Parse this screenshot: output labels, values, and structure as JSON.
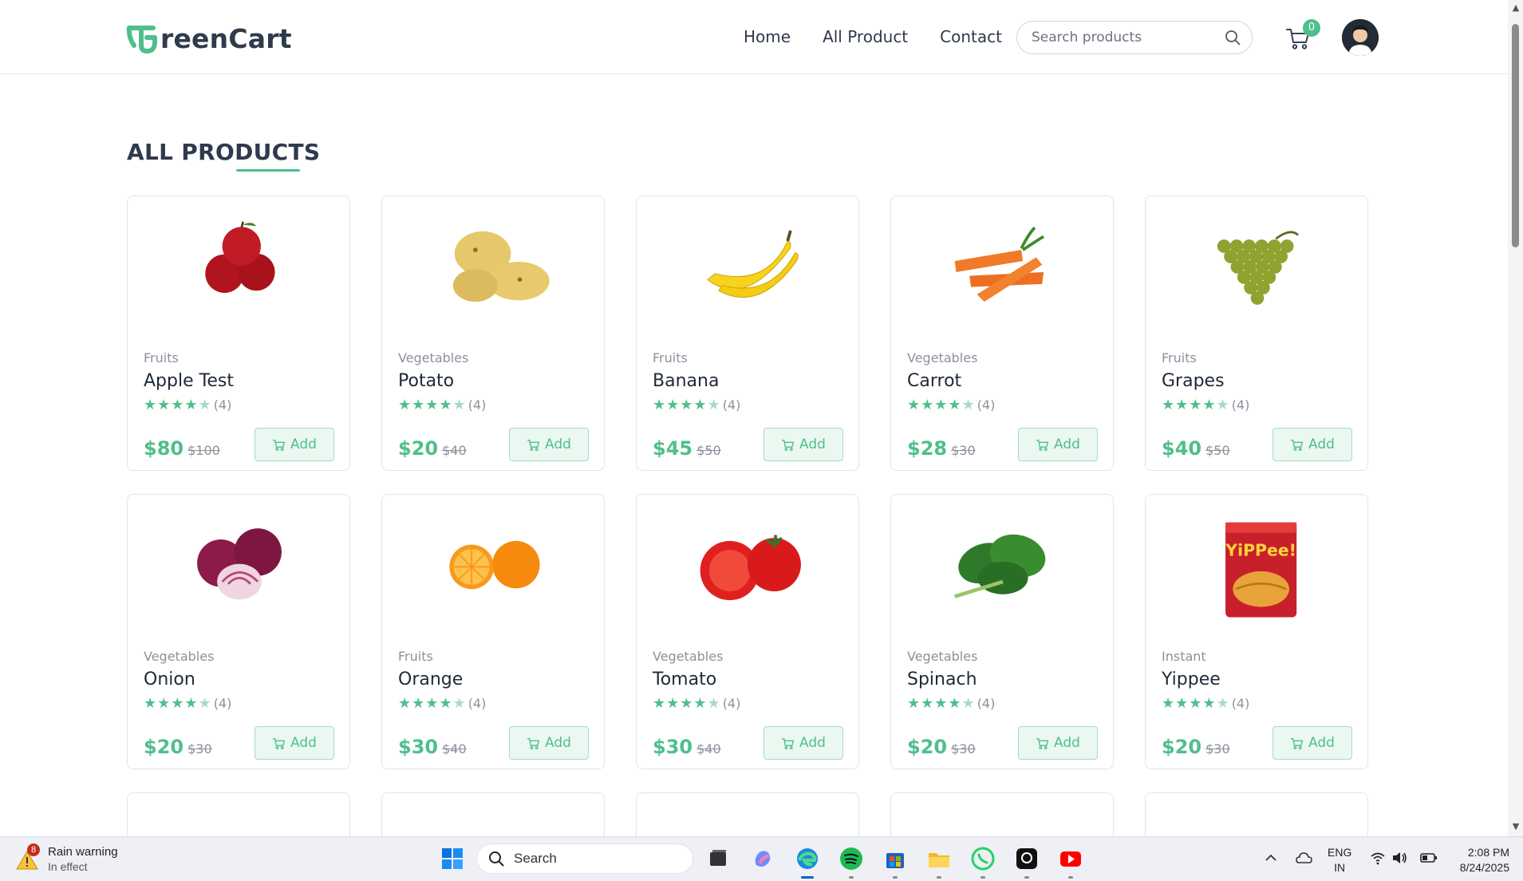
{
  "brand": {
    "name": "reenCart",
    "accent": "#4fbf8b"
  },
  "nav": {
    "links": [
      "Home",
      "All Product",
      "Contact"
    ]
  },
  "search": {
    "placeholder": "Search products"
  },
  "cart": {
    "count": "0"
  },
  "section": {
    "title": "ALL PRODUCTS"
  },
  "add_label": "Add",
  "products": [
    {
      "category": "Fruits",
      "name": "Apple Test",
      "rating": "(4)",
      "stars": 4,
      "price": "$80",
      "old_price": "$100",
      "image": "apple"
    },
    {
      "category": "Vegetables",
      "name": "Potato",
      "rating": "(4)",
      "stars": 4,
      "price": "$20",
      "old_price": "$40",
      "image": "potato"
    },
    {
      "category": "Fruits",
      "name": "Banana",
      "rating": "(4)",
      "stars": 4,
      "price": "$45",
      "old_price": "$50",
      "image": "banana"
    },
    {
      "category": "Vegetables",
      "name": "Carrot",
      "rating": "(4)",
      "stars": 4,
      "price": "$28",
      "old_price": "$30",
      "image": "carrot"
    },
    {
      "category": "Fruits",
      "name": "Grapes",
      "rating": "(4)",
      "stars": 4,
      "price": "$40",
      "old_price": "$50",
      "image": "grapes"
    },
    {
      "category": "Vegetables",
      "name": "Onion",
      "rating": "(4)",
      "stars": 4,
      "price": "$20",
      "old_price": "$30",
      "image": "onion"
    },
    {
      "category": "Fruits",
      "name": "Orange",
      "rating": "(4)",
      "stars": 4,
      "price": "$30",
      "old_price": "$40",
      "image": "orange"
    },
    {
      "category": "Vegetables",
      "name": "Tomato",
      "rating": "(4)",
      "stars": 4,
      "price": "$30",
      "old_price": "$40",
      "image": "tomato"
    },
    {
      "category": "Vegetables",
      "name": "Spinach",
      "rating": "(4)",
      "stars": 4,
      "price": "$20",
      "old_price": "$30",
      "image": "spinach"
    },
    {
      "category": "Instant",
      "name": "Yippee",
      "rating": "(4)",
      "stars": 4,
      "price": "$20",
      "old_price": "$30",
      "image": "yippee-noodles"
    }
  ],
  "taskbar": {
    "weather_title": "Rain warning",
    "weather_sub": "In effect",
    "weather_badge": "8",
    "search_label": "Search",
    "lang_top": "ENG",
    "lang_bottom": "IN",
    "time": "2:08 PM",
    "date": "8/24/2025"
  }
}
